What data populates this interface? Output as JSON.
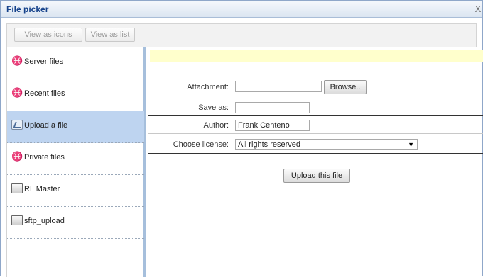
{
  "window": {
    "title": "File picker",
    "close_label": "X"
  },
  "toolbar": {
    "view_icons": "View as icons",
    "view_list": "View as list"
  },
  "sidebar": {
    "items": [
      {
        "label": "Server files",
        "icon": "repository-icon",
        "selected": false
      },
      {
        "label": "Recent files",
        "icon": "repository-icon",
        "selected": false
      },
      {
        "label": "Upload a file",
        "icon": "upload-icon",
        "selected": true
      },
      {
        "label": "Private files",
        "icon": "repository-icon",
        "selected": false
      },
      {
        "label": "RL Master",
        "icon": "drive-icon",
        "selected": false
      },
      {
        "label": "sftp_upload",
        "icon": "drive-icon",
        "selected": false
      }
    ]
  },
  "form": {
    "attachment_label": "Attachment:",
    "attachment_value": "",
    "browse_label": "Browse..",
    "saveas_label": "Save as:",
    "saveas_value": "",
    "author_label": "Author:",
    "author_value": "Frank Centeno",
    "license_label": "Choose license:",
    "license_value": "All rights reserved",
    "upload_label": "Upload this file"
  },
  "colors": {
    "selected_bg": "#bed4f0",
    "notice_bg": "#ffffcc",
    "title_text": "#15428b"
  }
}
